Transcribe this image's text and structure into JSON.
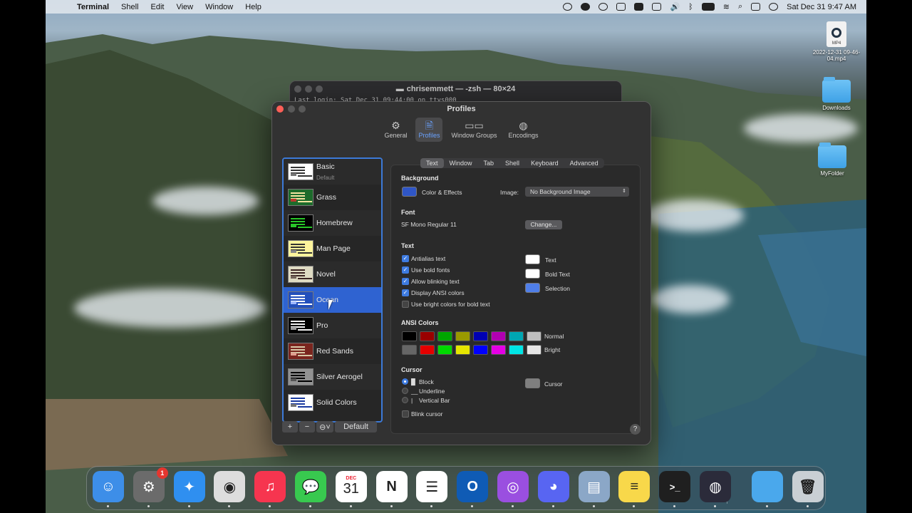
{
  "menubar": {
    "app_name": "Terminal",
    "menus": [
      "Shell",
      "Edit",
      "View",
      "Window",
      "Help"
    ],
    "clock": "Sat Dec 31  9:47 AM"
  },
  "desktop": {
    "items": [
      {
        "label": "2022-12-31 09-46-04.mp4",
        "badge": "MP4",
        "icon": "video-file-icon"
      },
      {
        "label": "Downloads",
        "icon": "folder-icon"
      },
      {
        "label": "MyFolder",
        "icon": "folder-icon"
      }
    ]
  },
  "terminal_window": {
    "title": "chrisemmett — -zsh — 80×24",
    "first_line": "Last login: Sat Dec 31 09:44:00 on ttys000"
  },
  "prefs": {
    "title": "Profiles",
    "toolbar": [
      {
        "label": "General",
        "icon": "gear-icon"
      },
      {
        "label": "Profiles",
        "icon": "profile-document-icon"
      },
      {
        "label": "Window Groups",
        "icon": "window-groups-icon"
      },
      {
        "label": "Encodings",
        "icon": "globe-icon"
      }
    ],
    "profiles": [
      {
        "name": "Basic",
        "sub": "Default",
        "bg": "#ffffff",
        "fg": "#333333",
        "acc": "#777777"
      },
      {
        "name": "Grass",
        "bg": "#1d6b2b",
        "fg": "#f3e3a0",
        "acc": "#b8372c"
      },
      {
        "name": "Homebrew",
        "bg": "#000000",
        "fg": "#28c828",
        "acc": "#28c828"
      },
      {
        "name": "Man Page",
        "bg": "#fef49c",
        "fg": "#333333",
        "acc": "#888888"
      },
      {
        "name": "Novel",
        "bg": "#dfdbc3",
        "fg": "#3b2322",
        "acc": "#73635a"
      },
      {
        "name": "Ocean",
        "bg": "#224fbc",
        "fg": "#ffffff",
        "acc": "#9fb8ff"
      },
      {
        "name": "Pro",
        "bg": "#000000",
        "fg": "#f2f2f2",
        "acc": "#9a9a9a"
      },
      {
        "name": "Red Sands",
        "bg": "#7a251e",
        "fg": "#d7c9a7",
        "acc": "#e0a090"
      },
      {
        "name": "Silver Aerogel",
        "bg": "#929292",
        "fg": "#000000",
        "acc": "#555555"
      },
      {
        "name": "Solid Colors",
        "bg": "#ffffff",
        "fg": "#1a3aa0",
        "acc": "#777777"
      }
    ],
    "selected_profile": "Ocean",
    "sidebar_footer": {
      "add": "+",
      "remove": "−",
      "more": "⊖˅",
      "default": "Default"
    },
    "tabs": [
      "Text",
      "Window",
      "Tab",
      "Shell",
      "Keyboard",
      "Advanced"
    ],
    "active_tab": "Text",
    "background": {
      "heading": "Background",
      "color_label": "Color & Effects",
      "color": "#2f56c6",
      "image_label": "Image:",
      "image_value": "No Background Image"
    },
    "font": {
      "heading": "Font",
      "value": "SF Mono Regular 11",
      "change_button": "Change..."
    },
    "text": {
      "heading": "Text",
      "options": [
        {
          "label": "Antialias text",
          "checked": true
        },
        {
          "label": "Use bold fonts",
          "checked": true
        },
        {
          "label": "Allow blinking text",
          "checked": true
        },
        {
          "label": "Display ANSI colors",
          "checked": true
        },
        {
          "label": "Use bright colors for bold text",
          "checked": false
        }
      ],
      "colors": [
        {
          "label": "Text",
          "color": "#ffffff"
        },
        {
          "label": "Bold Text",
          "color": "#ffffff"
        },
        {
          "label": "Selection",
          "color": "#4f7ee8"
        }
      ]
    },
    "ansi": {
      "heading": "ANSI Colors",
      "normal_label": "Normal",
      "bright_label": "Bright",
      "normal": [
        "#000000",
        "#990000",
        "#00a600",
        "#999900",
        "#0000b2",
        "#b200b2",
        "#00a6b2",
        "#bfbfbf"
      ],
      "bright": [
        "#666666",
        "#e50000",
        "#00d900",
        "#e5e500",
        "#0000ff",
        "#e500e5",
        "#00e5e5",
        "#e5e5e5"
      ]
    },
    "cursor": {
      "heading": "Cursor",
      "styles": [
        {
          "label": "Block",
          "glyph": "▉",
          "selected": true
        },
        {
          "label": "Underline",
          "glyph": "__",
          "selected": false
        },
        {
          "label": "Vertical Bar",
          "glyph": "|",
          "selected": false
        }
      ],
      "blink_label": "Blink cursor",
      "blink": false,
      "color_label": "Cursor",
      "color": "#7f7f7f"
    },
    "help": "?"
  },
  "dock": {
    "apps": [
      {
        "name": "Finder",
        "icon": "finder-icon",
        "color": "#3d8ee8",
        "glyph": "☺"
      },
      {
        "name": "System Preferences",
        "icon": "gear-icon",
        "color": "#6b6b6b",
        "glyph": "⚙",
        "badge": "1"
      },
      {
        "name": "Safari",
        "icon": "compass-icon",
        "color": "#2f8ff0",
        "glyph": "✦"
      },
      {
        "name": "Chrome",
        "icon": "chrome-icon",
        "color": "#dddddd",
        "glyph": "◉"
      },
      {
        "name": "Music",
        "icon": "music-note-icon",
        "color": "#f6354f",
        "glyph": "♫"
      },
      {
        "name": "Messages",
        "icon": "speech-bubble-icon",
        "color": "#38c94f",
        "glyph": "💬"
      },
      {
        "name": "Calendar",
        "icon": "calendar-icon",
        "color": "#ffffff",
        "month": "DEC",
        "day": "31"
      },
      {
        "name": "Notion",
        "icon": "notion-icon",
        "color": "#ffffff",
        "glyph": "N"
      },
      {
        "name": "Reminders",
        "icon": "list-icon",
        "color": "#ffffff",
        "glyph": "☰"
      },
      {
        "name": "Outlook",
        "icon": "outlook-icon",
        "color": "#0f5bb5",
        "glyph": "O"
      },
      {
        "name": "Podcasts",
        "icon": "podcast-icon",
        "color": "#9a4fe0",
        "glyph": "◎"
      },
      {
        "name": "Discord",
        "icon": "discord-icon",
        "color": "#5865f2",
        "glyph": "◕"
      },
      {
        "name": "Preview",
        "icon": "preview-icon",
        "color": "#8ba7c7",
        "glyph": "▤"
      },
      {
        "name": "Notes",
        "icon": "notes-icon",
        "color": "#f8d84a",
        "glyph": "≡"
      },
      {
        "name": "Terminal",
        "icon": "terminal-icon",
        "color": "#1f1f1f",
        "glyph": ">_"
      },
      {
        "name": "OBS",
        "icon": "obs-icon",
        "color": "#2b2b3a",
        "glyph": "◍"
      },
      {
        "name": "Downloads",
        "icon": "folder-icon",
        "color": "#4aa8ec",
        "glyph": ""
      },
      {
        "name": "Trash",
        "icon": "trash-icon",
        "color": "#c9cfd4",
        "glyph": "🗑"
      }
    ]
  }
}
